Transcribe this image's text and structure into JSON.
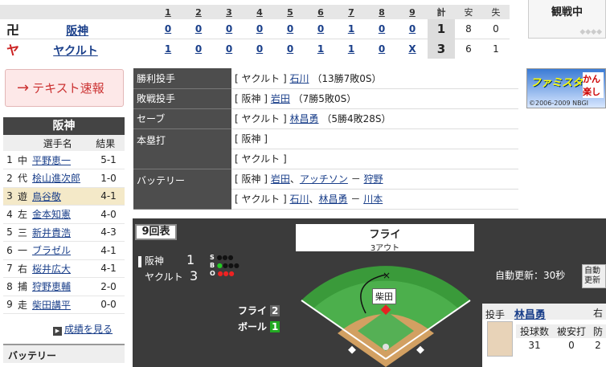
{
  "scoreboard": {
    "innings": [
      "1",
      "2",
      "3",
      "4",
      "5",
      "6",
      "7",
      "8",
      "9"
    ],
    "col_r": "計",
    "col_h": "安",
    "col_e": "失",
    "teams": [
      {
        "name": "阪神",
        "icon": "tigers-logo",
        "scores": [
          "0",
          "0",
          "0",
          "0",
          "0",
          "0",
          "1",
          "0",
          "0"
        ],
        "r": "1",
        "h": "8",
        "e": "0"
      },
      {
        "name": "ヤクルト",
        "icon": "swallows-logo",
        "scores": [
          "1",
          "0",
          "0",
          "0",
          "0",
          "1",
          "1",
          "0",
          "X"
        ],
        "r": "3",
        "h": "6",
        "e": "1"
      }
    ]
  },
  "status": "観戦中",
  "text_button": "テキスト速報",
  "ad": {
    "title": "ファミスタ",
    "text": "かん 楽し",
    "copyright": "©2006-2009 NBGI"
  },
  "lineup": {
    "team": "阪神",
    "headers": [
      "選手名",
      "結果"
    ],
    "rows": [
      {
        "n": "1",
        "pos": "中",
        "name": "平野恵一",
        "res": "5-1"
      },
      {
        "n": "2",
        "pos": "代",
        "name": "桧山進次郎",
        "res": "1-0"
      },
      {
        "n": "3",
        "pos": "遊",
        "name": "鳥谷敬",
        "res": "4-1"
      },
      {
        "n": "4",
        "pos": "左",
        "name": "金本知憲",
        "res": "4-0"
      },
      {
        "n": "5",
        "pos": "三",
        "name": "新井貴浩",
        "res": "4-3"
      },
      {
        "n": "6",
        "pos": "一",
        "name": "ブラゼル",
        "res": "4-1"
      },
      {
        "n": "7",
        "pos": "右",
        "name": "桜井広大",
        "res": "4-1"
      },
      {
        "n": "8",
        "pos": "捕",
        "name": "狩野恵輔",
        "res": "2-0"
      },
      {
        "n": "9",
        "pos": "走",
        "name": "柴田講平",
        "res": "0-0"
      }
    ],
    "more": "成績を見る",
    "battery": "バッテリー"
  },
  "results": {
    "win": {
      "label": "勝利投手",
      "team": "[ ヤクルト ]",
      "player": "石川",
      "note": "（13勝7敗0S）"
    },
    "lose": {
      "label": "敗戦投手",
      "team": "[ 阪神 ]",
      "player": "岩田",
      "note": "（7勝5敗0S）"
    },
    "save": {
      "label": "セーブ",
      "team": "[ ヤクルト ]",
      "player": "林昌勇",
      "note": "（5勝4敗28S）"
    },
    "hr": {
      "label": "本塁打",
      "team1": "[ 阪神 ]",
      "team2": "[ ヤクルト ]"
    },
    "battery": {
      "label": "バッテリー",
      "t1": "[ 阪神 ]",
      "t1p1": "岩田",
      "t1p2": "アッチソン",
      "t1c": "狩野",
      "t2": "[ ヤクルト ]",
      "t2p1": "石川",
      "t2p2": "林昌勇",
      "t2c": "川本",
      "sep": "、",
      "dash": "－"
    }
  },
  "game": {
    "inning": "9回表",
    "play": "フライ",
    "outs_text": "3アウト",
    "teams": [
      {
        "name": "阪神",
        "score": "1"
      },
      {
        "name": "ヤクルト",
        "score": "3"
      }
    ],
    "sbo": [
      "S",
      "B",
      "O"
    ],
    "auto_update": "自動更新：30秒",
    "auto_btn": "自動 更新",
    "fielder": "柴田",
    "stats": [
      {
        "label": "フライ",
        "val": "2"
      },
      {
        "label": "ボール",
        "val": "1"
      }
    ],
    "pitcher_label": "投手",
    "pitcher_name": "林昌勇",
    "pitcher_extra": "右",
    "pitch_headers": [
      "投球数",
      "被安打",
      "防"
    ],
    "pitch_vals": [
      "31",
      "0",
      "2"
    ]
  }
}
